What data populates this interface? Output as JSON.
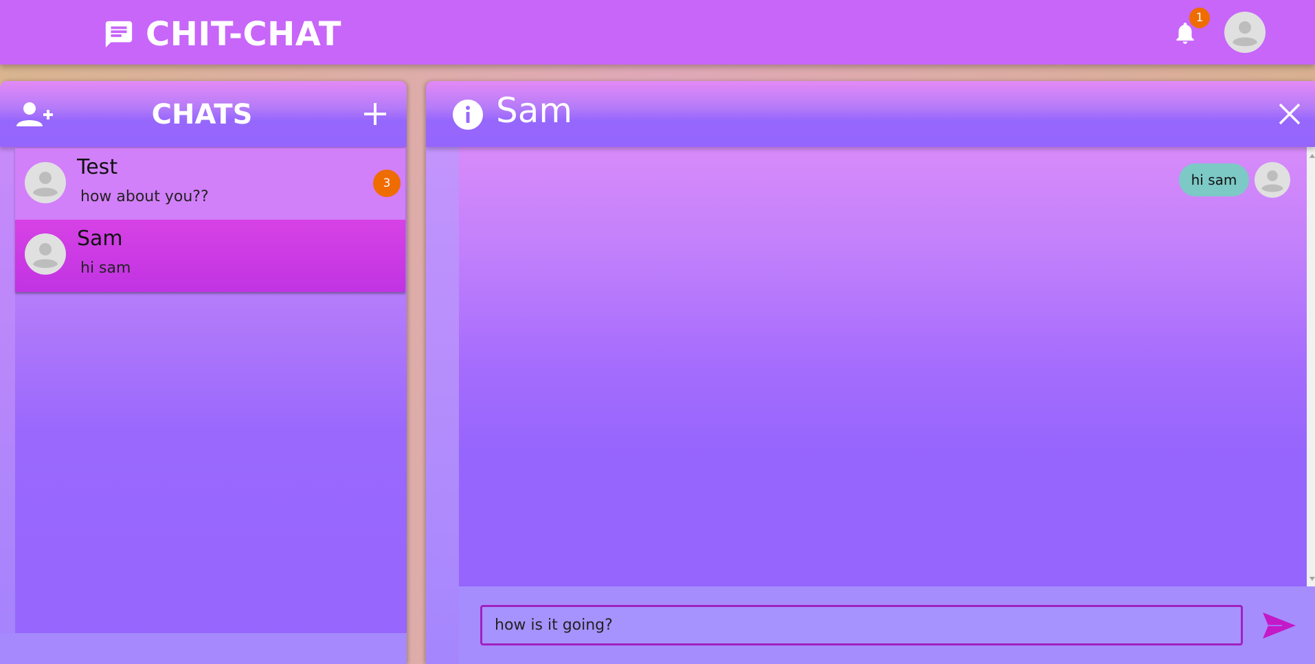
{
  "app": {
    "title": "CHIT-CHAT",
    "notification_count": "1"
  },
  "colors": {
    "appbar": "#c766f9",
    "badge": "#ef6c00",
    "selected_chat": "#c133e3",
    "bubble": "#7cc9c6",
    "send": "#c419c7"
  },
  "chats_panel": {
    "title": "CHATS",
    "icons": {
      "left": "add-user-icon",
      "right": "plus-icon"
    },
    "items": [
      {
        "name": "Test",
        "preview": "how about you??",
        "unread": "3",
        "selected": false
      },
      {
        "name": "Sam",
        "preview": "hi sam",
        "unread": null,
        "selected": true
      }
    ]
  },
  "chat_panel": {
    "title": "Sam",
    "icons": {
      "left": "info-icon",
      "right": "close-icon"
    },
    "messages": [
      {
        "text": "hi sam",
        "from": "self"
      }
    ],
    "input": {
      "value": "how is it going?"
    }
  }
}
